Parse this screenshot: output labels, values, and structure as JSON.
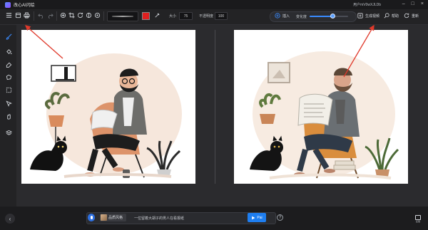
{
  "app": {
    "title": "改心AI闪绘",
    "user_id": "用户mV0wXJLDb",
    "window_buttons": [
      "–",
      "□",
      "×"
    ]
  },
  "toolbar": {
    "left_icons": [
      "menu-icon",
      "open-file-icon",
      "print-icon",
      "undo-icon",
      "redo-icon",
      "transform-icon",
      "crop-icon",
      "rotate-icon",
      "flip-icon",
      "adjust-icon"
    ],
    "brush_color": "#e02020",
    "size_label": "大小",
    "size_value": "75",
    "opacity_label": "不透明度",
    "opacity_value": "100"
  },
  "generation": {
    "insert_label": "插入",
    "strength_label": "变化度",
    "strength_value": 0.6,
    "generate_video_label": "生成视频",
    "help_label": "帮助",
    "refresh_label": "重新"
  },
  "sidebar": {
    "tools": [
      "brush-icon",
      "fill-bucket-icon",
      "eraser-icon",
      "lasso-icon",
      "select-rect-icon",
      "pen-icon",
      "hand-icon",
      "layers-icon"
    ]
  },
  "bottom": {
    "back": "‹",
    "style_chip_label": "品质风格",
    "prompt_text": "一位留着大胡子的男人在看报纸",
    "paint_button_label": "Pai",
    "info": "?",
    "corner_label": "反馈"
  },
  "colors": {
    "accent": "#1e7ef0",
    "annotation_arrow": "#e0392b",
    "background": "#1f1f21"
  }
}
